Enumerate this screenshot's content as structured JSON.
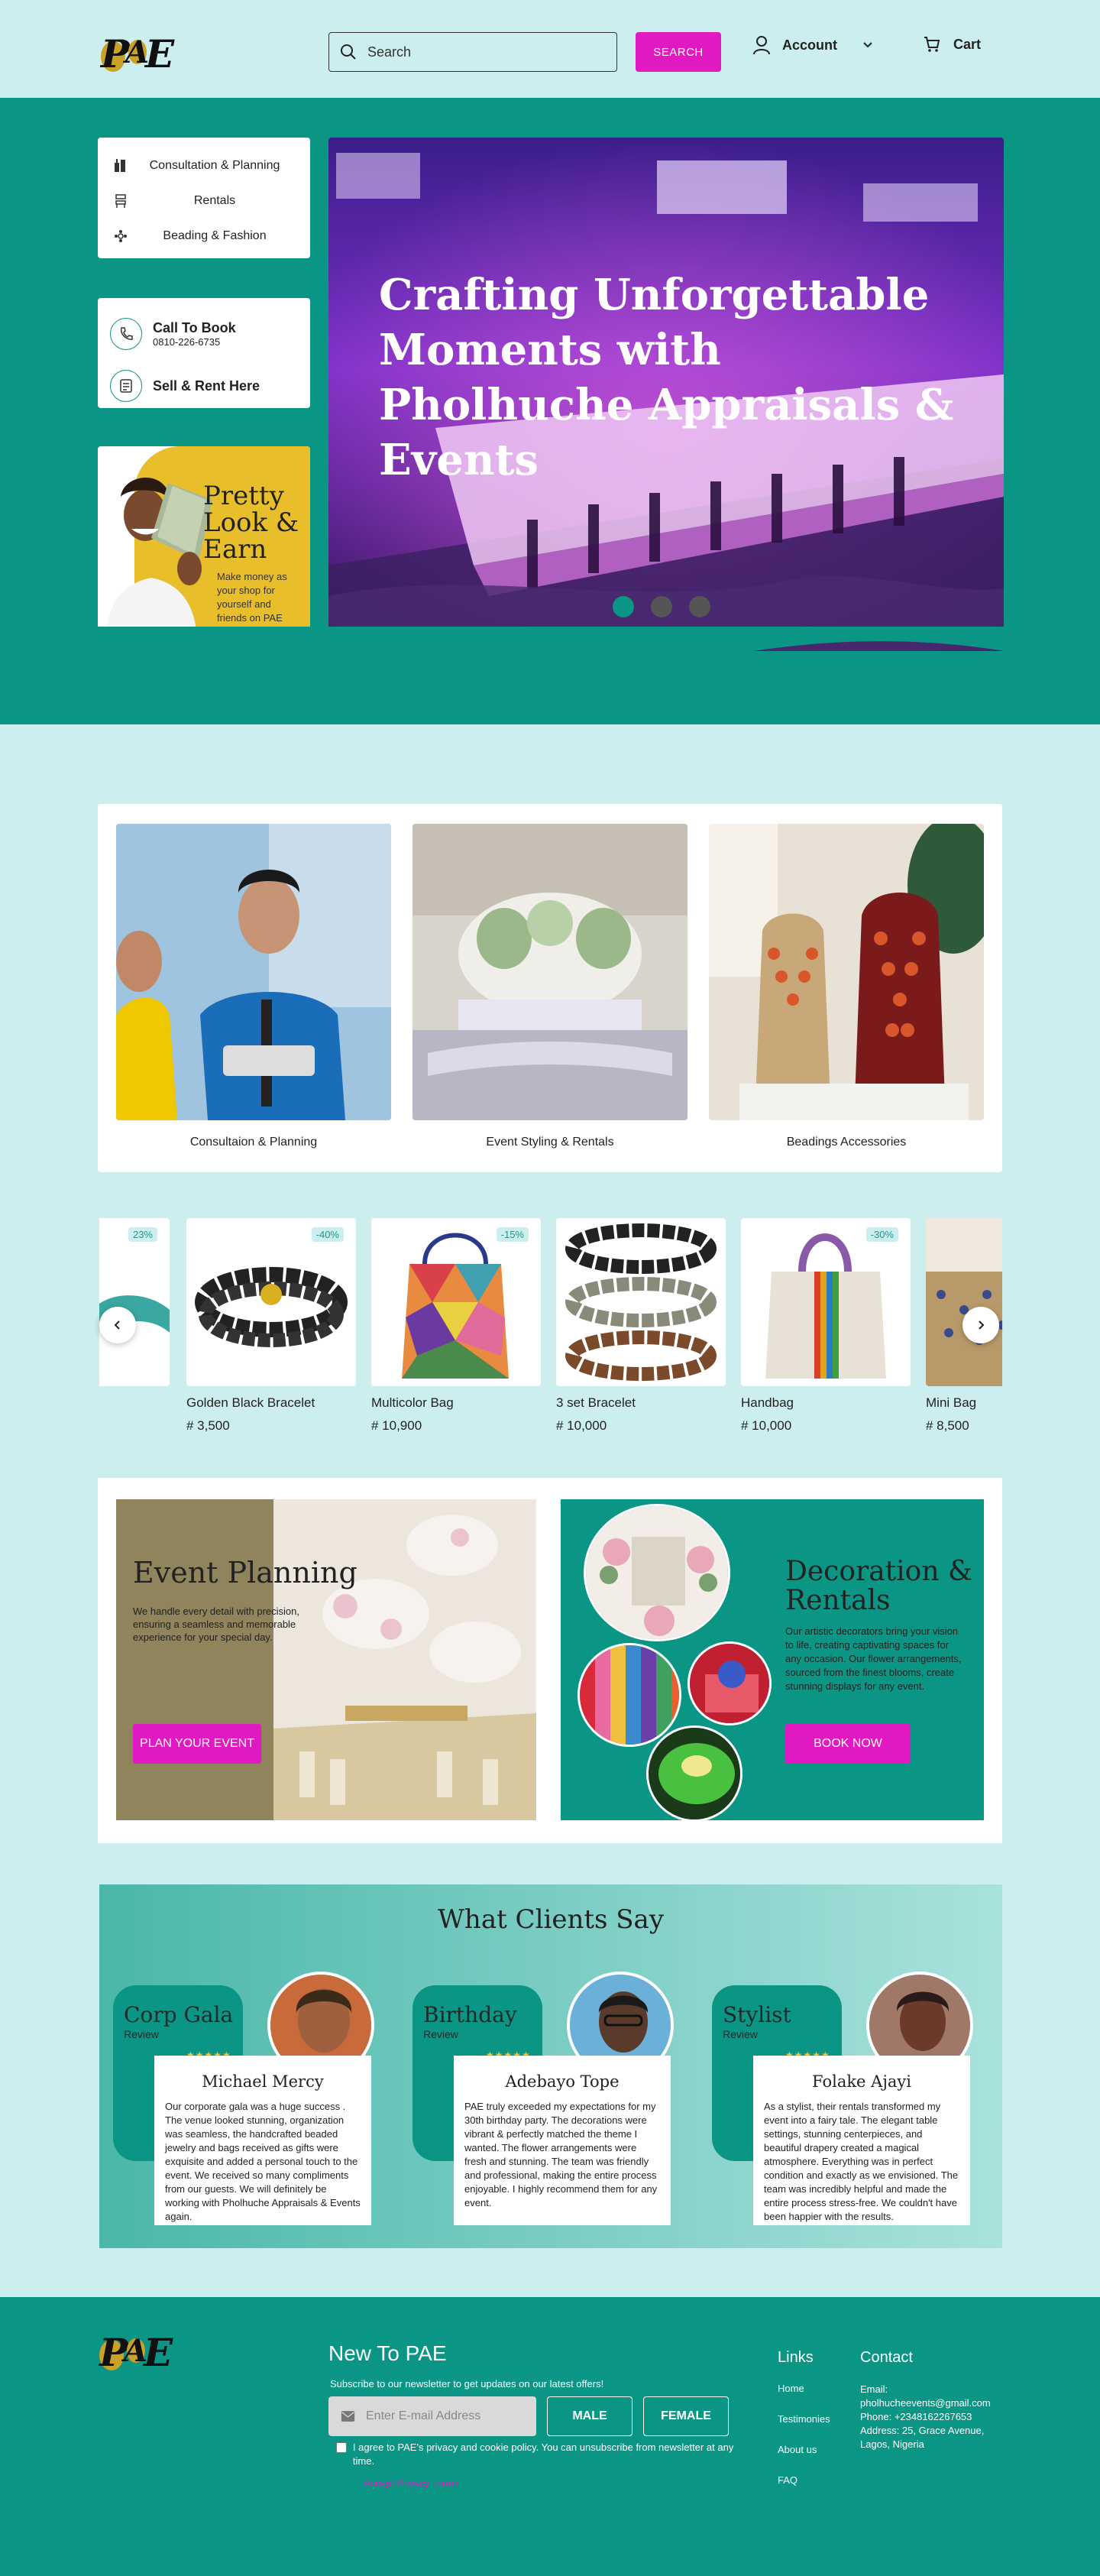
{
  "header": {
    "search_placeholder": "Search",
    "search_button": "SEARCH",
    "account_label": "Account",
    "cart_label": "Cart"
  },
  "sidebar": {
    "categories": [
      {
        "label": "Consultation & Planning",
        "icon": "planning-icon"
      },
      {
        "label": "Rentals",
        "icon": "rentals-icon"
      },
      {
        "label": "Beading & Fashion",
        "icon": "beading-icon"
      }
    ],
    "call_title": "Call To Book",
    "call_phone": "0810-226-6735",
    "sell_rent": "Sell & Rent Here",
    "promo_title": "Pretty Look & Earn",
    "promo_text": "Make money as your shop for yourself and friends on PAE"
  },
  "hero": {
    "headline": "Crafting Unforgettable Moments with Pholhuche Appraisals & Events",
    "slide_count": 3,
    "active_slide": 1
  },
  "services": [
    {
      "caption": "Consultaion & Planning"
    },
    {
      "caption": "Event Styling & Rentals"
    },
    {
      "caption": "Beadings Accessories"
    }
  ],
  "products": [
    {
      "name": "",
      "price": "",
      "badge": "23%"
    },
    {
      "name": "Golden Black Bracelet",
      "price": "# 3,500",
      "badge": "-40%"
    },
    {
      "name": "Multicolor Bag",
      "price": "# 10,900",
      "badge": "-15%"
    },
    {
      "name": "3 set Bracelet",
      "price": "# 10,000",
      "badge": ""
    },
    {
      "name": "Handbag",
      "price": "# 10,000",
      "badge": "-30%"
    },
    {
      "name": "Mini Bag",
      "price": "# 8,500",
      "badge": ""
    }
  ],
  "features": {
    "event_title": "Event Planning",
    "event_text": "We handle every detail with precision, ensuring a seamless and memorable experience for your special day.",
    "event_button": "PLAN YOUR EVENT",
    "deco_title": "Decoration & Rentals",
    "deco_text": "Our artistic decorators bring your vision to life, creating captivating spaces for any occasion. Our flower arrangements, sourced from the finest blooms, create stunning displays for any event.",
    "deco_button": "BOOK NOW"
  },
  "testimonials": {
    "title": "What Clients Say",
    "items": [
      {
        "role": "Corp Gala",
        "review": "Review",
        "stars": "★★★★★",
        "name": "Michael Mercy",
        "text": "Our corporate gala was a huge success . The venue looked stunning, organization was seamless, the handcrafted beaded jewelry and bags received as gifts were exquisite and added a personal touch to the event. We received so many compliments from our guests. We will definitely be working with Pholhuche Appraisals & Events again."
      },
      {
        "role": "Birthday",
        "review": "Review",
        "stars": "★★★★★",
        "name": "Adebayo Tope",
        "text": "PAE truly exceeded my expectations for my 30th birthday party. The decorations were vibrant & perfectly matched the theme I wanted. The flower arrangements were fresh and stunning. The team was friendly and professional, making the entire process enjoyable. I highly recommend them for any event."
      },
      {
        "role": "Stylist",
        "review": "Review",
        "stars": "★★★★★",
        "name": "Folake Ajayi",
        "text": "As a stylist, their rentals transformed my event into a fairy tale. The elegant table settings, stunning centerpieces, and beautiful drapery created a magical atmosphere. Everything was in perfect condition and exactly as we envisioned. The team was incredibly helpful and made the entire process stress-free. We couldn't have been happier with the results."
      }
    ]
  },
  "footer": {
    "newsletter_title": "New To PAE",
    "newsletter_sub": "Subscribe to our newsletter to get updates on our latest offers!",
    "email_placeholder": "Enter E-mail Address",
    "male": "MALE",
    "female": "FEMALE",
    "agree": "I agree to PAE's privacy and cookie policy. You can unsubscribe from newsletter at any time.",
    "privacy_link": "Accept Privacy Terms",
    "links_title": "Links",
    "links": [
      "Home",
      "Testimonies",
      "About us",
      "FAQ"
    ],
    "contact_title": "Contact",
    "email": "Email: pholhucheevents@gmail.com",
    "phone": "Phone: +2348162267653",
    "address": "Address: 25, Grace Avenue, Lagos, Nigeria"
  },
  "colors": {
    "teal": "#0a9584",
    "mint": "#cdeeee",
    "pink": "#e019c2",
    "yellow": "#e8be2a"
  }
}
